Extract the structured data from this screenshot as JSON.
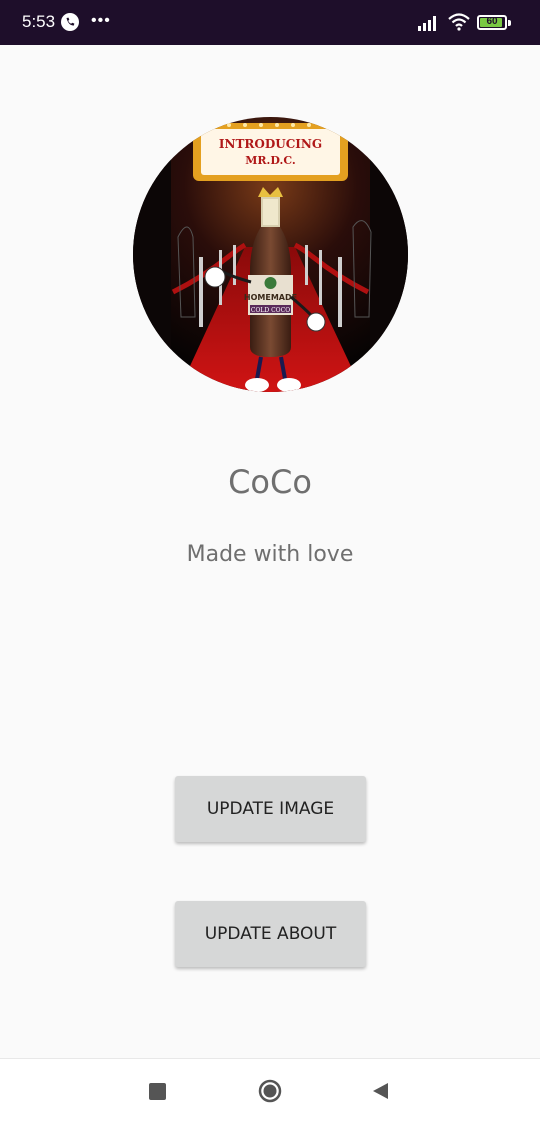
{
  "status_bar": {
    "time": "5:53",
    "battery_level": "60",
    "icons": [
      "phone-icon",
      "more-icon",
      "signal-icon",
      "wifi-icon",
      "battery-icon"
    ]
  },
  "profile": {
    "image_banner_line1": "INTRODUCING",
    "image_banner_line2": "MR.D.C.",
    "image_label": "HOMEMADE",
    "image_sublabel": "COLD COCO",
    "title": "CoCo",
    "about": "Made with love"
  },
  "actions": {
    "update_image_label": "UPDATE IMAGE",
    "update_about_label": "UPDATE ABOUT"
  },
  "nav": {
    "icons": [
      "recents-icon",
      "home-icon",
      "back-icon"
    ]
  },
  "colors": {
    "status_bar": "#1e0e2a",
    "background": "#fafafa",
    "button": "#d6d7d7",
    "text": "#6f6f6f"
  }
}
